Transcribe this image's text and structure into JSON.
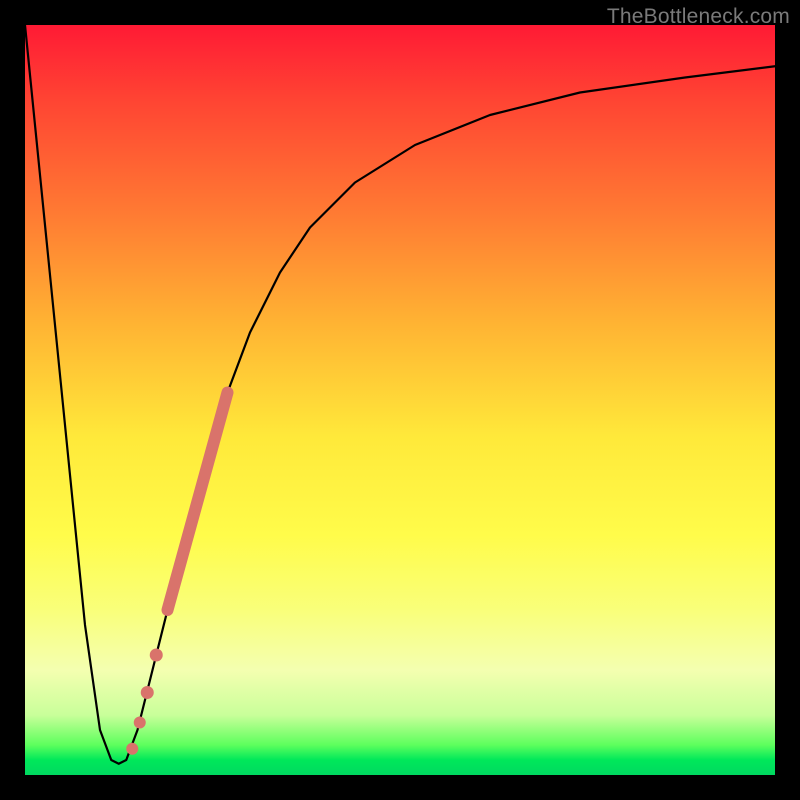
{
  "attribution": "TheBottleneck.com",
  "chart_data": {
    "type": "line",
    "title": "",
    "xlabel": "",
    "ylabel": "",
    "xlim": [
      0,
      100
    ],
    "ylim": [
      0,
      100
    ],
    "series": [
      {
        "name": "bottleneck-curve",
        "style": "thin-black",
        "x": [
          0,
          3,
          6,
          8,
          10,
          11.5,
          12.5,
          13.5,
          15,
          17,
          19,
          21,
          23,
          25,
          27,
          30,
          34,
          38,
          44,
          52,
          62,
          74,
          88,
          100
        ],
        "y": [
          100,
          70,
          40,
          20,
          6,
          2,
          1.5,
          2,
          6,
          14,
          22,
          30,
          38,
          45,
          51,
          59,
          67,
          73,
          79,
          84,
          88,
          91,
          93,
          94.5
        ]
      },
      {
        "name": "highlight-segment-main",
        "style": "thick-salmon",
        "x": [
          19,
          27
        ],
        "y": [
          22,
          51
        ]
      },
      {
        "name": "highlight-dot-1",
        "style": "dot-salmon",
        "x": [
          17.5
        ],
        "y": [
          16
        ]
      },
      {
        "name": "highlight-dot-2",
        "style": "dot-salmon",
        "x": [
          16.3
        ],
        "y": [
          11
        ]
      },
      {
        "name": "highlight-dot-3",
        "style": "dot-salmon",
        "x": [
          15.3
        ],
        "y": [
          7
        ]
      },
      {
        "name": "highlight-dot-4",
        "style": "dot-salmon",
        "x": [
          14.3
        ],
        "y": [
          3.5
        ]
      }
    ],
    "colors": {
      "curve": "#000000",
      "highlight": "#d9736b"
    }
  }
}
